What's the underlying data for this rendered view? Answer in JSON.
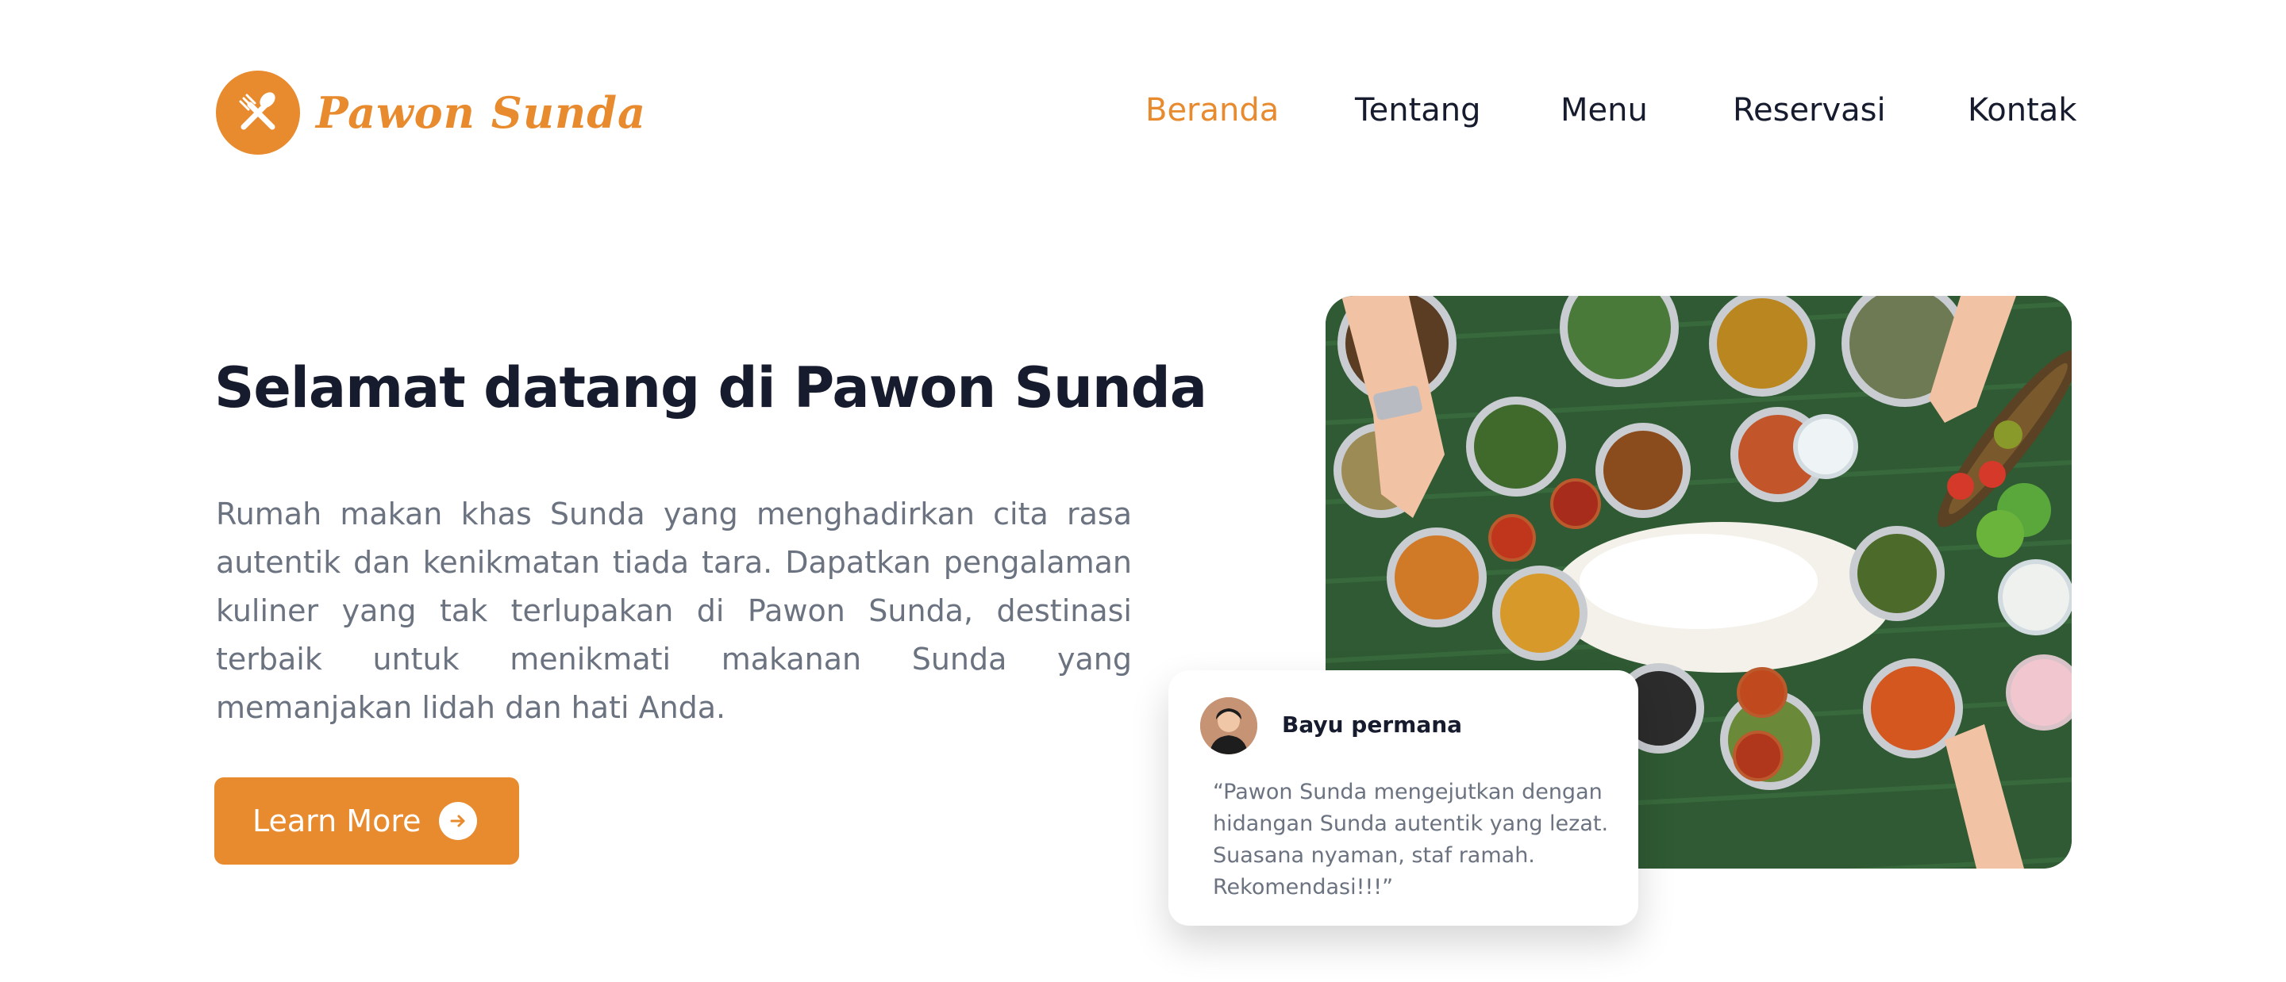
{
  "brand": {
    "name": "Pawon Sunda",
    "icon": "fork-knife-icon",
    "color": "#e88a2e"
  },
  "nav": {
    "items": [
      "Beranda",
      "Tentang",
      "Menu",
      "Reservasi",
      "Kontak"
    ],
    "active": "Beranda"
  },
  "hero": {
    "title": "Selamat datang di Pawon Sunda",
    "description": "Rumah makan khas Sunda yang menghadirkan cita rasa autentik dan kenikmatan tiada tara. Dapatkan pengalaman kuliner yang tak terlupakan di Pawon Sunda, destinasi terbaik untuk menikmati makanan Sunda yang memanjakan lidah dan hati Anda.",
    "cta_label": "Learn More",
    "cta_icon": "arrow-right-circle-icon",
    "image_subject": "sundanese-food-spread"
  },
  "testimonial": {
    "name": "Bayu permana",
    "quote": "“Pawon Sunda mengejutkan dengan hidangan Sunda autentik yang lezat. Suasana nyaman, staf ramah. Rekomendasi!!!”"
  },
  "colors": {
    "accent": "#e88a2e",
    "heading": "#161b2e",
    "body_text": "#6b7280",
    "background": "#ffffff"
  }
}
